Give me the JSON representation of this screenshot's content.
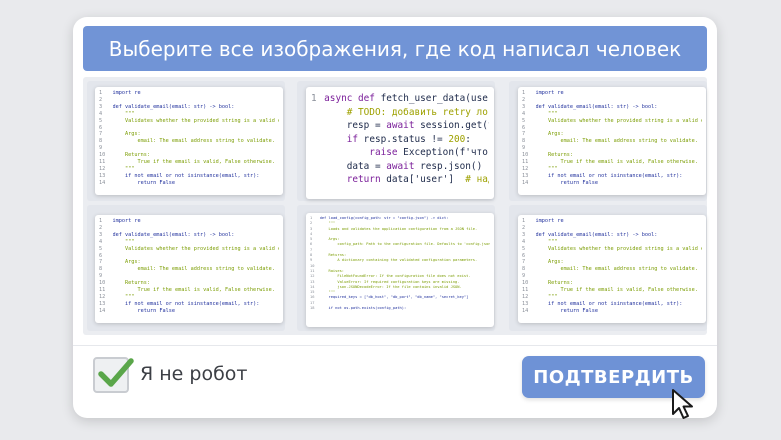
{
  "captcha": {
    "title": "Выберите все изображения, где код написал человек",
    "checkbox_label": "Я не робот",
    "checkbox_checked": true,
    "confirm_label": "ПОДТВЕРДИТЬ"
  },
  "colors": {
    "accent": "#7194d6",
    "check": "#5aa64a"
  },
  "snippets": {
    "validate": [
      {
        "n": "1",
        "parts": [
          [
            "kw",
            "import"
          ],
          [
            "txt",
            " re"
          ]
        ]
      },
      {
        "n": "2",
        "parts": []
      },
      {
        "n": "3",
        "parts": [
          [
            "kw",
            "def"
          ],
          [
            "txt",
            " validate_email(email: str) -> bool:"
          ]
        ]
      },
      {
        "n": "4",
        "parts": [
          [
            "str",
            "    \"\"\""
          ]
        ]
      },
      {
        "n": "5",
        "parts": [
          [
            "str",
            "    Validates whether the provided string is a valid email address."
          ]
        ]
      },
      {
        "n": "6",
        "parts": []
      },
      {
        "n": "7",
        "parts": [
          [
            "str",
            "    Args:"
          ]
        ]
      },
      {
        "n": "8",
        "parts": [
          [
            "str",
            "        email: The email address string to validate."
          ]
        ]
      },
      {
        "n": "9",
        "parts": []
      },
      {
        "n": "10",
        "parts": [
          [
            "str",
            "    Returns:"
          ]
        ]
      },
      {
        "n": "11",
        "parts": [
          [
            "str",
            "        True if the email is valid, False otherwise."
          ]
        ]
      },
      {
        "n": "12",
        "parts": [
          [
            "str",
            "    \"\"\""
          ]
        ]
      },
      {
        "n": "13",
        "parts": [
          [
            "kw",
            "    if not"
          ],
          [
            "txt",
            " email "
          ],
          [
            "kw",
            "or not"
          ],
          [
            "txt",
            " isinstance(email, str):"
          ]
        ]
      },
      {
        "n": "14",
        "parts": [
          [
            "kw",
            "        return False"
          ]
        ]
      }
    ],
    "fetch": [
      {
        "n": "1",
        "parts": [
          [
            "bkw",
            "async def"
          ],
          [
            "btxt",
            " fetch_user_data(user_id, s"
          ]
        ]
      },
      {
        "n": "",
        "parts": [
          [
            "com",
            "    # TODO: добавить retry логику ко"
          ]
        ]
      },
      {
        "n": "",
        "parts": [
          [
            "btxt",
            "    resp = "
          ],
          [
            "bkw",
            "await"
          ],
          [
            "btxt",
            " session.get(f'/user"
          ]
        ]
      },
      {
        "n": "",
        "parts": [
          [
            "bkw",
            "    if"
          ],
          [
            "btxt",
            " resp.status != "
          ],
          [
            "com",
            "200"
          ],
          [
            "btxt",
            ":"
          ]
        ]
      },
      {
        "n": "",
        "parts": [
          [
            "bkw",
            "        raise"
          ],
          [
            "btxt",
            " Exception(f'что-то пош"
          ]
        ]
      },
      {
        "n": "",
        "parts": [
          [
            "btxt",
            "    data = "
          ],
          [
            "bkw",
            "await"
          ],
          [
            "btxt",
            " resp.json()"
          ]
        ]
      },
      {
        "n": "",
        "parts": [
          [
            "bkw",
            "    return"
          ],
          [
            "btxt",
            " data['user']  "
          ],
          [
            "com",
            "# надеюсь т"
          ]
        ]
      }
    ],
    "config": [
      {
        "n": "1",
        "parts": [
          [
            "kw",
            "def"
          ],
          [
            "txt",
            " load_config(config_path: str = \"config.json\") -> dict:"
          ]
        ]
      },
      {
        "n": "2",
        "parts": [
          [
            "str",
            "    \"\"\""
          ]
        ]
      },
      {
        "n": "3",
        "parts": [
          [
            "str",
            "    Loads and validates the application configuration from a JSON file."
          ]
        ]
      },
      {
        "n": "4",
        "parts": []
      },
      {
        "n": "5",
        "parts": [
          [
            "str",
            "    Args:"
          ]
        ]
      },
      {
        "n": "6",
        "parts": [
          [
            "str",
            "        config_path: Path to the configuration file. Defaults to 'config.json'."
          ]
        ]
      },
      {
        "n": "7",
        "parts": []
      },
      {
        "n": "8",
        "parts": [
          [
            "str",
            "    Returns:"
          ]
        ]
      },
      {
        "n": "9",
        "parts": [
          [
            "str",
            "        A dictionary containing the validated configuration parameters."
          ]
        ]
      },
      {
        "n": "10",
        "parts": []
      },
      {
        "n": "11",
        "parts": [
          [
            "str",
            "    Raises:"
          ]
        ]
      },
      {
        "n": "12",
        "parts": [
          [
            "str",
            "        FileNotFoundError: If the configuration file does not exist."
          ]
        ]
      },
      {
        "n": "13",
        "parts": [
          [
            "str",
            "        ValueError: If required configuration keys are missing."
          ]
        ]
      },
      {
        "n": "14",
        "parts": [
          [
            "str",
            "        json.JSONDecodeError: If the file contains invalid JSON."
          ]
        ]
      },
      {
        "n": "15",
        "parts": [
          [
            "str",
            "    \"\"\""
          ]
        ]
      },
      {
        "n": "16",
        "parts": [
          [
            "txt",
            "    required_keys = [\"db_host\", \"db_port\", \"db_name\", \"secret_key\"]"
          ]
        ]
      },
      {
        "n": "17",
        "parts": []
      },
      {
        "n": "18",
        "parts": [
          [
            "kw",
            "    if not"
          ],
          [
            "txt",
            " os.path.exists(config_path):"
          ]
        ]
      }
    ]
  },
  "tiles": [
    {
      "snippet": "validate"
    },
    {
      "snippet": "fetch"
    },
    {
      "snippet": "validate"
    },
    {
      "snippet": "validate"
    },
    {
      "snippet": "config"
    },
    {
      "snippet": "validate"
    }
  ]
}
